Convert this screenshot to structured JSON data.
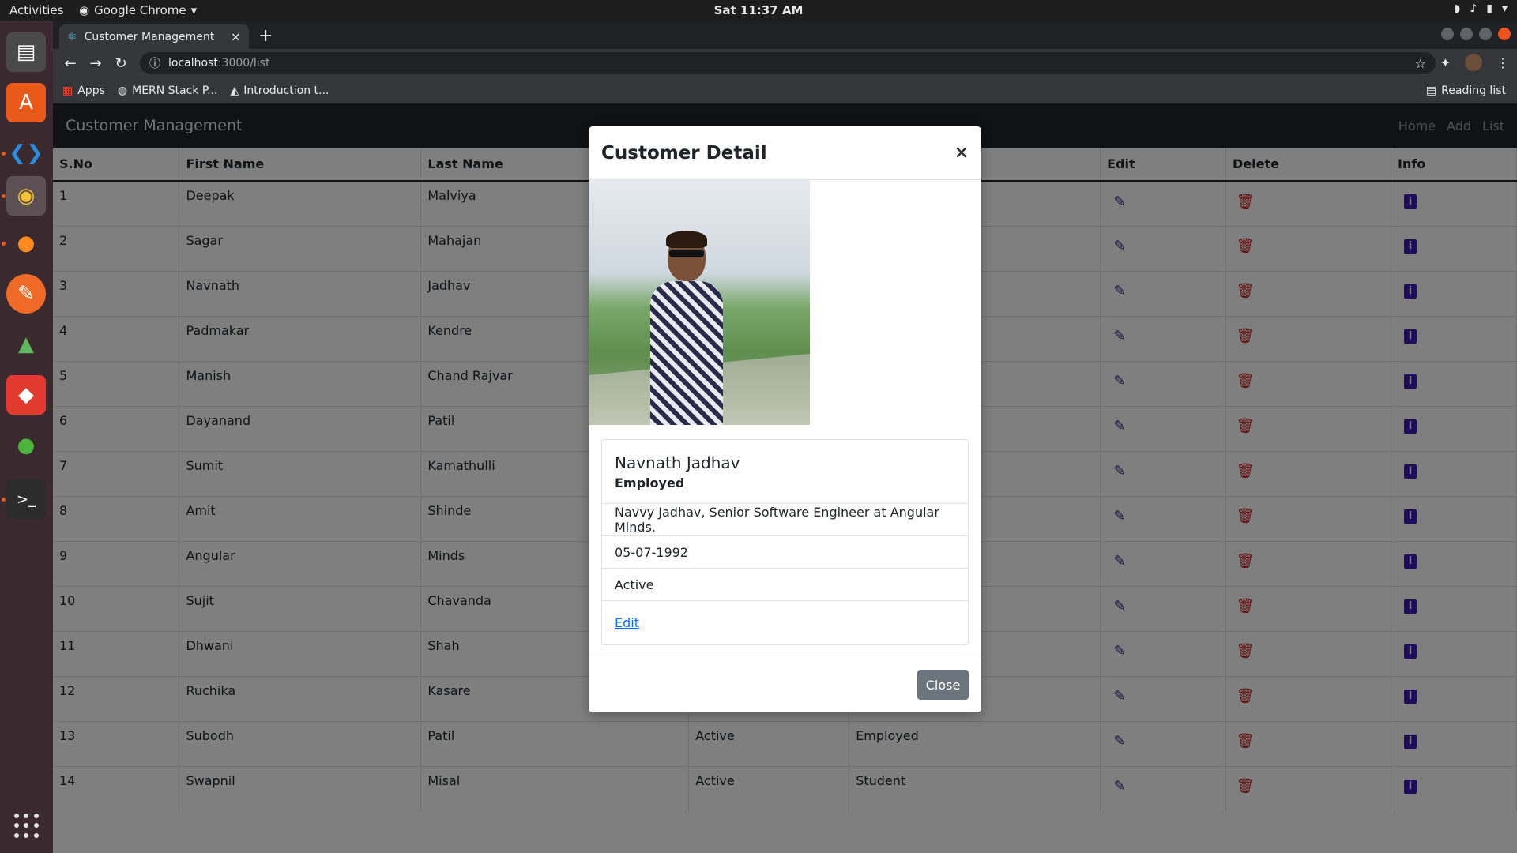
{
  "topbar": {
    "activities": "Activities",
    "app": "Google Chrome",
    "clock": "Sat 11:37 AM"
  },
  "browser": {
    "tab_title": "Customer Management",
    "url_host": "localhost",
    "url_path": ":3000/list",
    "bookmarks": [
      "Apps",
      "MERN Stack P...",
      "Introduction t..."
    ],
    "reading_list": "Reading list"
  },
  "navbar": {
    "brand": "Customer Management",
    "links": [
      "Home",
      "Add",
      "List"
    ]
  },
  "table": {
    "headers": [
      "S.No",
      "First Name",
      "Last Name",
      "",
      "",
      "Edit",
      "Delete",
      "Info"
    ],
    "rows": [
      {
        "sno": "1",
        "first": "Deepak",
        "last": "Malviya",
        "status": "",
        "job": ""
      },
      {
        "sno": "2",
        "first": "Sagar",
        "last": "Mahajan",
        "status": "",
        "job": ""
      },
      {
        "sno": "3",
        "first": "Navnath",
        "last": "Jadhav",
        "status": "",
        "job": ""
      },
      {
        "sno": "4",
        "first": "Padmakar",
        "last": "Kendre",
        "status": "",
        "job": ""
      },
      {
        "sno": "5",
        "first": "Manish",
        "last": "Chand Rajvar",
        "status": "",
        "job": ""
      },
      {
        "sno": "6",
        "first": "Dayanand",
        "last": "Patil",
        "status": "",
        "job": ""
      },
      {
        "sno": "7",
        "first": "Sumit",
        "last": "Kamathulli",
        "status": "",
        "job": ""
      },
      {
        "sno": "8",
        "first": "Amit",
        "last": "Shinde",
        "status": "",
        "job": ""
      },
      {
        "sno": "9",
        "first": "Angular",
        "last": "Minds",
        "status": "",
        "job": ""
      },
      {
        "sno": "10",
        "first": "Sujit",
        "last": "Chavanda",
        "status": "",
        "job": ""
      },
      {
        "sno": "11",
        "first": "Dhwani",
        "last": "Shah",
        "status": "",
        "job": ""
      },
      {
        "sno": "12",
        "first": "Ruchika",
        "last": "Kasare",
        "status": "",
        "job": ""
      },
      {
        "sno": "13",
        "first": "Subodh",
        "last": "Patil",
        "status": "Active",
        "job": "Employed"
      },
      {
        "sno": "14",
        "first": "Swapnil",
        "last": "Misal",
        "status": "Active",
        "job": "Student"
      }
    ]
  },
  "modal": {
    "title": "Customer Detail",
    "close_x": "×",
    "name": "Navnath Jadhav",
    "employment": "Employed",
    "description": "Navvy Jadhav, Senior Software Engineer at Angular Minds.",
    "dob": "05-07-1992",
    "status": "Active",
    "edit_link": "Edit",
    "close_button": "Close"
  },
  "icons": {
    "edit": "pencil-icon",
    "delete": "trash-icon",
    "info": "info-icon"
  },
  "colors": {
    "navbar": "#212529",
    "edit": "#2b1a7a",
    "delete": "#c41b1b",
    "info": "#3d18b8",
    "close_button": "#6c757d"
  }
}
